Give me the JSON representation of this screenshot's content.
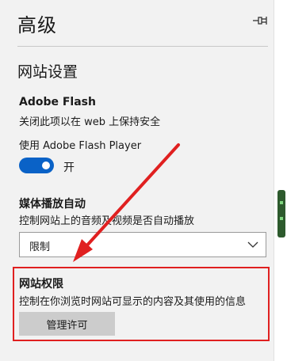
{
  "header": {
    "title": "高级",
    "pin_icon": "pin-icon"
  },
  "section": {
    "title": "网站设置"
  },
  "flash": {
    "title": "Adobe Flash",
    "description": "关闭此项以在 web 上保持安全",
    "use_label": "使用 Adobe Flash Player",
    "toggle_on": true,
    "toggle_state_label": "开"
  },
  "autoplay": {
    "title": "媒体播放自动",
    "description": "控制网站上的音频及视频是否自动播放",
    "selected_value": "限制",
    "dropdown_icon": "chevron-down-icon"
  },
  "permissions": {
    "title": "网站权限",
    "description": "控制在你浏览时网站可显示的内容及其使用的信息",
    "button_label": "管理许可"
  },
  "colors": {
    "panel_bg": "#f2f2f2",
    "toggle_on": "#0a62c7",
    "annotation_red": "#e02020",
    "button_bg": "#cccccc"
  }
}
